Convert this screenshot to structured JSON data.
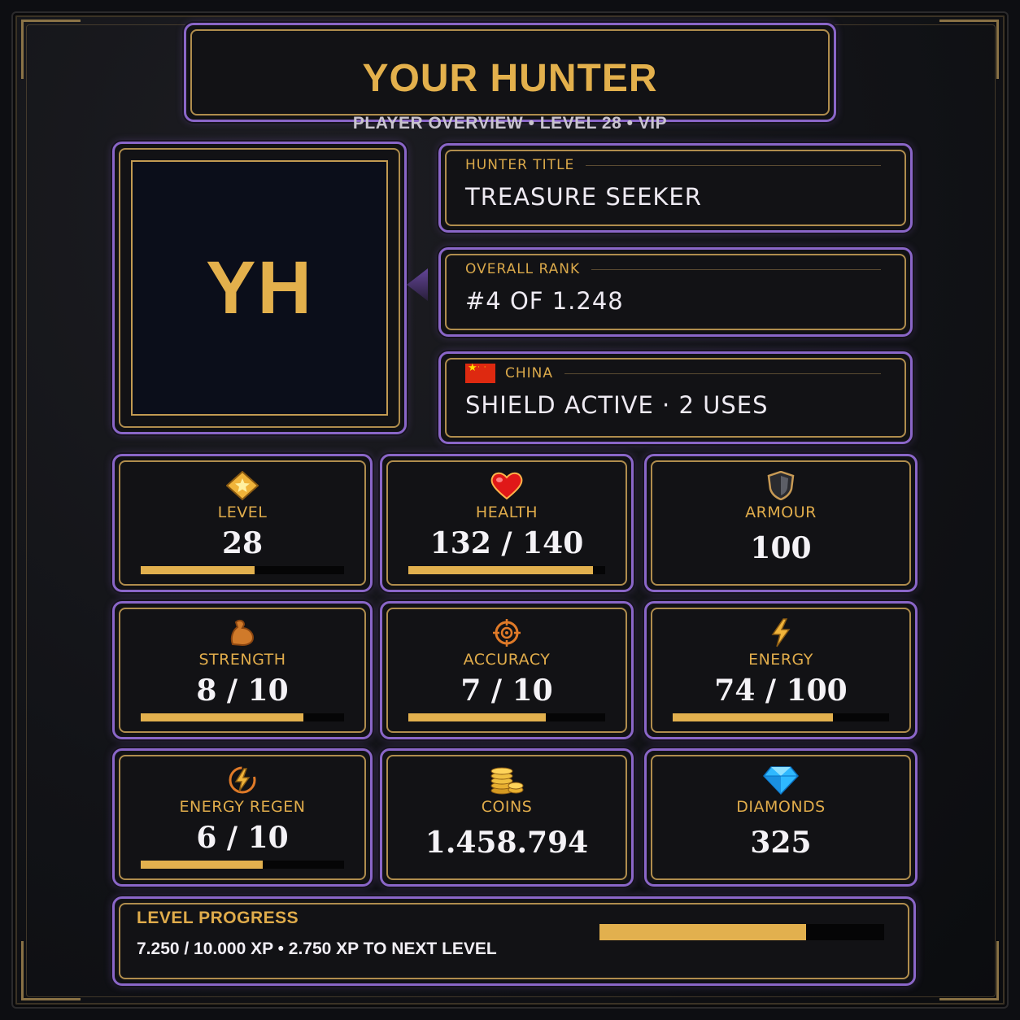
{
  "header": {
    "title": "YOUR HUNTER",
    "subtitle": "PLAYER OVERVIEW  •  LEVEL 28  •  VIP"
  },
  "avatar": {
    "initials": "YH"
  },
  "info": {
    "title_label": "HUNTER TITLE",
    "title_value": "TREASURE SEEKER",
    "rank_label": "OVERALL RANK",
    "rank_value": "#4  OF  1.248",
    "country_label": "CHINA",
    "country_flag": "china-flag",
    "shield_value": "SHIELD ACTIVE  ·  2 USES"
  },
  "stats": [
    {
      "icon": "star-icon",
      "label": "LEVEL",
      "value": "28",
      "fill": 0.56
    },
    {
      "icon": "heart-icon",
      "label": "HEALTH",
      "value": "132 / 140",
      "fill": 0.94
    },
    {
      "icon": "shield-icon",
      "label": "ARMOUR",
      "value": "100",
      "fill": null
    },
    {
      "icon": "flex-arm-icon",
      "label": "STRENGTH",
      "value": "8 / 10",
      "fill": 0.8
    },
    {
      "icon": "crosshair-icon",
      "label": "ACCURACY",
      "value": "7 / 10",
      "fill": 0.7
    },
    {
      "icon": "lightning-icon",
      "label": "ENERGY",
      "value": "74 / 100",
      "fill": 0.74
    },
    {
      "icon": "energy-regen-icon",
      "label": "ENERGY REGEN",
      "value": "6 / 10",
      "fill": 0.6
    },
    {
      "icon": "coins-icon",
      "label": "COINS",
      "value": "1.458.794",
      "fill": null
    },
    {
      "icon": "diamond-icon",
      "label": "DIAMONDS",
      "value": "325",
      "fill": null
    }
  ],
  "progress": {
    "label": "LEVEL PROGRESS",
    "text": "7.250 / 10.000 XP   •   2.750 XP TO NEXT LEVEL",
    "fill": 0.725
  },
  "colors": {
    "accent_gold": "#e2b04e",
    "panel_border_purple": "#8a66c8",
    "text_white": "#f4f2f6"
  }
}
